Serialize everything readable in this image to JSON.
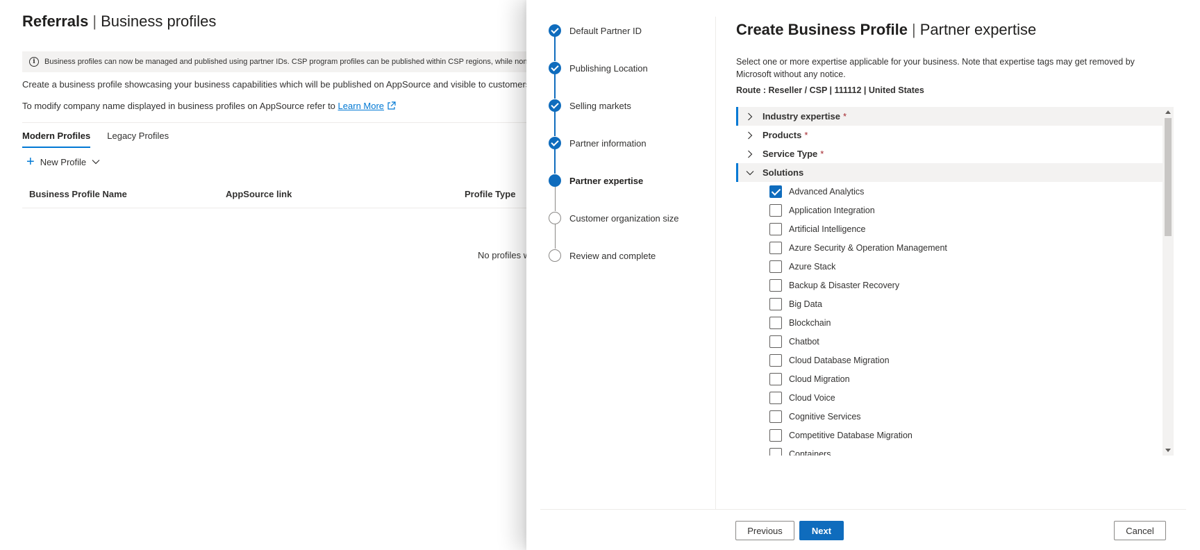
{
  "page": {
    "title_bold": "Referrals",
    "title_sep": "|",
    "title_sub": "Business profiles",
    "info_text": "Business profiles can now be managed and published using partner IDs. CSP program profiles can be published within CSP regions, while non-CSP",
    "desc_1": "Create a business profile showcasing your business capabilities which will be published on AppSource and visible to customers to re",
    "desc_2_prefix": "To modify company name displayed in business profiles on AppSource refer to",
    "learn_more": "Learn More",
    "tabs": [
      {
        "label": "Modern Profiles",
        "active": true
      },
      {
        "label": "Legacy Profiles",
        "active": false
      }
    ],
    "new_profile": "New Profile",
    "columns": [
      "Business Profile Name",
      "AppSource link",
      "Profile Type"
    ],
    "empty_message": "No profiles w"
  },
  "panel": {
    "steps": [
      {
        "label": "Default Partner ID",
        "state": "done"
      },
      {
        "label": "Publishing Location",
        "state": "done"
      },
      {
        "label": "Selling markets",
        "state": "done"
      },
      {
        "label": "Partner information",
        "state": "done"
      },
      {
        "label": "Partner expertise",
        "state": "current"
      },
      {
        "label": "Customer organization size",
        "state": "todo"
      },
      {
        "label": "Review and complete",
        "state": "todo"
      }
    ],
    "title_bold": "Create Business Profile",
    "title_sep": "|",
    "title_sub": "Partner expertise",
    "description": "Select one or more expertise applicable for your business. Note that expertise tags may get removed by Microsoft without any notice.",
    "route": "Route : Reseller / CSP | 111112 | United States",
    "sections": [
      {
        "label": "Industry expertise",
        "required": "*",
        "expanded": false
      },
      {
        "label": "Products",
        "required": "*",
        "expanded": false
      },
      {
        "label": "Service Type",
        "required": "*",
        "expanded": false
      },
      {
        "label": "Solutions",
        "required": "",
        "expanded": true
      }
    ],
    "solutions": [
      {
        "label": "Advanced Analytics",
        "checked": true
      },
      {
        "label": "Application Integration",
        "checked": false
      },
      {
        "label": "Artificial Intelligence",
        "checked": false
      },
      {
        "label": "Azure Security & Operation Management",
        "checked": false
      },
      {
        "label": "Azure Stack",
        "checked": false
      },
      {
        "label": "Backup & Disaster Recovery",
        "checked": false
      },
      {
        "label": "Big Data",
        "checked": false
      },
      {
        "label": "Blockchain",
        "checked": false
      },
      {
        "label": "Chatbot",
        "checked": false
      },
      {
        "label": "Cloud Database Migration",
        "checked": false
      },
      {
        "label": "Cloud Migration",
        "checked": false
      },
      {
        "label": "Cloud Voice",
        "checked": false
      },
      {
        "label": "Cognitive Services",
        "checked": false
      },
      {
        "label": "Competitive Database Migration",
        "checked": false
      },
      {
        "label": "Containers",
        "checked": false
      }
    ],
    "buttons": {
      "previous": "Previous",
      "next": "Next",
      "cancel": "Cancel"
    }
  },
  "colors": {
    "accent": "#0f6cbd",
    "link": "#0078d4",
    "required": "#a4262c"
  }
}
